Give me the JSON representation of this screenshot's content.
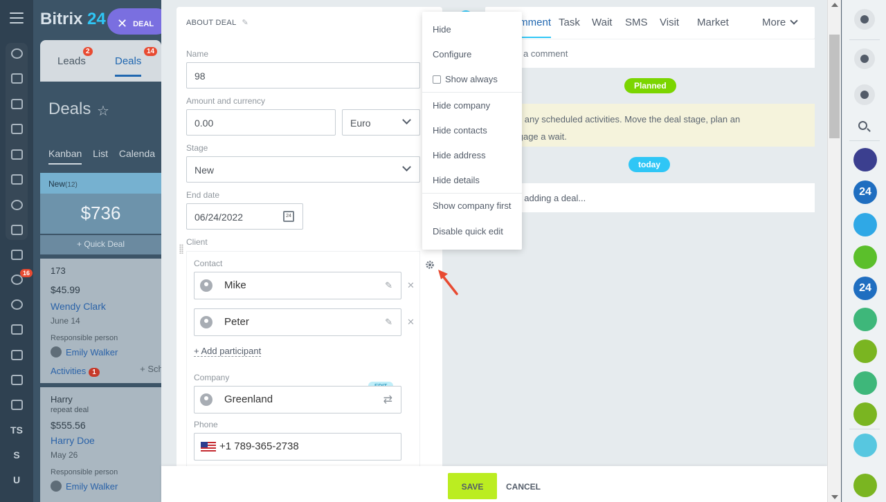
{
  "leftnav": {
    "badge": "16",
    "text_items": [
      "TS",
      "S",
      "U"
    ]
  },
  "crm": {
    "logo_prefix": "Bitrix",
    "logo_suffix": "24",
    "deal_chip": "DEAL",
    "tabs": [
      {
        "label": "Leads",
        "badge": "2"
      },
      {
        "label": "Deals",
        "badge": "14"
      }
    ],
    "title": "Deals",
    "views": [
      "Kanban",
      "List",
      "Calenda"
    ],
    "stage": {
      "name": "New",
      "count": "(12)",
      "sum": "$736"
    },
    "quick_deal": "+ Quick Deal",
    "cards": [
      {
        "title": "173",
        "sub": "",
        "price": "$45.99",
        "contact": "Wendy Clark",
        "date": "June 14",
        "resp_label": "Responsible person",
        "resp": "Emily Walker",
        "activities": "Activities",
        "activities_count": "1",
        "schedule": "+ Sche"
      },
      {
        "title": "Harry",
        "sub": "repeat deal",
        "price": "$555.56",
        "contact": "Harry Doe",
        "date": "May 26",
        "resp_label": "Responsible person",
        "resp": "Emily Walker"
      }
    ]
  },
  "form": {
    "section_title": "ABOUT DEAL",
    "name_label": "Name",
    "name_value": "98",
    "amount_label": "Amount and currency",
    "amount_value": "0.00",
    "currency_value": "Euro",
    "stage_label": "Stage",
    "stage_value": "New",
    "end_date_label": "End date",
    "end_date_value": "06/24/2022",
    "calendar_day": "24",
    "client_label": "Client",
    "contact_label": "Contact",
    "contacts": [
      "Mike",
      "Peter"
    ],
    "add_participant": "+ Add participant",
    "company_label": "Company",
    "company_value": "Greenland",
    "edit_tag": "EDIT",
    "phone_label": "Phone",
    "phone_value": "+1 789-365-2738"
  },
  "timeline": {
    "tabs": [
      "Comment",
      "Task",
      "Wait",
      "SMS",
      "Visit",
      "Market"
    ],
    "more": "More",
    "comment_placeholder": "a comment",
    "planned_pill": "Planned",
    "warn_line1": "n't have any scheduled activities. Move the deal stage, plan an",
    "warn_line2": "y or engage a wait.",
    "today_pill": "today",
    "adding_text": "e now adding a deal..."
  },
  "menu": {
    "items": [
      "Hide",
      "Configure",
      "Show always",
      "Hide company",
      "Hide contacts",
      "Hide address",
      "Hide details",
      "Show company first",
      "Disable quick edit"
    ]
  },
  "footer": {
    "save": "SAVE",
    "cancel": "CANCEL"
  },
  "rightbar": {
    "badges": [
      "24",
      "24"
    ]
  },
  "colors": {
    "accent": "#2fc6f6",
    "save": "#bbed21",
    "planned": "#7bd500",
    "today": "#2fc6f6",
    "badge": "#e84a31"
  }
}
